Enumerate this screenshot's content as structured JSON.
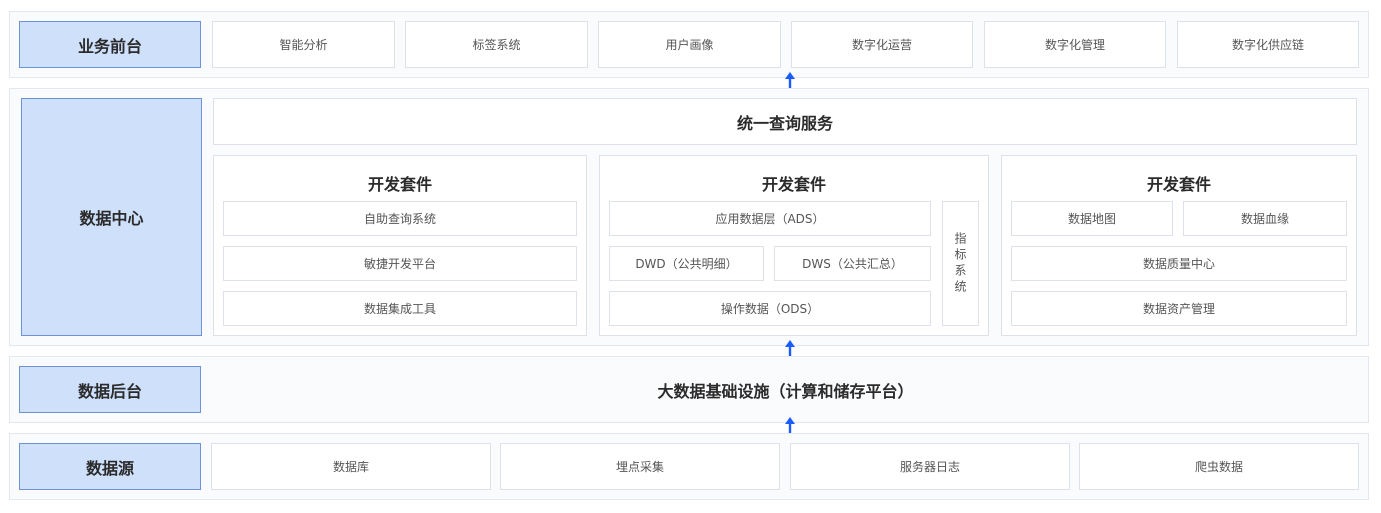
{
  "business_front": {
    "label": "业务前台",
    "items": [
      "智能分析",
      "标签系统",
      "用户画像",
      "数字化运营",
      "数字化管理",
      "数字化供应链"
    ]
  },
  "data_center": {
    "label": "数据中心",
    "query_service": "统一查询服务",
    "suite_left": {
      "title": "开发套件",
      "items": [
        "自助查询系统",
        "敏捷开发平台",
        "数据集成工具"
      ]
    },
    "suite_mid": {
      "title": "开发套件",
      "ads": "应用数据层（ADS）",
      "dwd": "DWD（公共明细）",
      "dws": "DWS（公共汇总）",
      "ods": "操作数据（ODS）",
      "metrics": "指标系统"
    },
    "suite_right": {
      "title": "开发套件",
      "map": "数据地图",
      "lineage": "数据血缘",
      "quality": "数据质量中心",
      "assets": "数据资产管理"
    }
  },
  "data_backend": {
    "label": "数据后台",
    "infra": "大数据基础设施（计算和储存平台）"
  },
  "data_source": {
    "label": "数据源",
    "items": [
      "数据库",
      "埋点采集",
      "服务器日志",
      "爬虫数据"
    ]
  },
  "colors": {
    "label_fill": "#cfe0fb",
    "label_border": "#6d93d6",
    "arrow": "#1a5cff"
  }
}
